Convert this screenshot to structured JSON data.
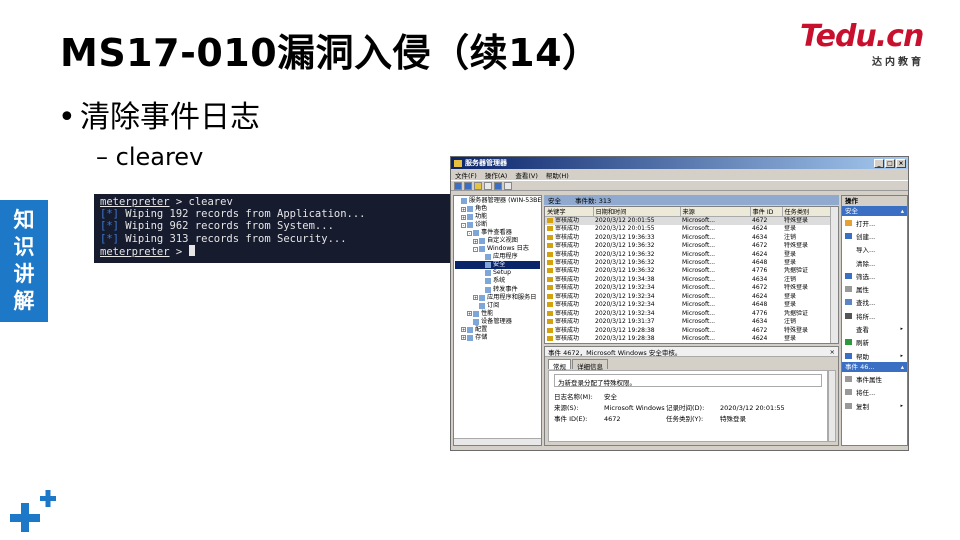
{
  "slide": {
    "title": "MS17-010漏洞入侵（续14）",
    "bullet": "清除事件日志",
    "sub_bullet": "– clearev",
    "side_tab": [
      "知",
      "识",
      "讲",
      "解"
    ]
  },
  "logo": {
    "main": "Tedu",
    "suffix": ".cn",
    "sub": "达内教育"
  },
  "colors": {
    "accent_blue": "#1e78c8",
    "logo_red": "#c8102e",
    "terminal_bg": "#161b2e"
  },
  "terminal": {
    "prompt": "meterpreter",
    "command": " > clearev",
    "lines": [
      {
        "tag": "[*]",
        "text": " Wiping 192 records from Application..."
      },
      {
        "tag": "[*]",
        "text": " Wiping 962 records from System..."
      },
      {
        "tag": "[*]",
        "text": " Wiping 313 records from Security..."
      }
    ],
    "prompt_end": " > "
  },
  "window": {
    "title": "服务器管理器",
    "menu": [
      "文件(F)",
      "操作(A)",
      "查看(V)",
      "帮助(H)"
    ],
    "tree": [
      {
        "label": "服务器管理器 (WIN-53BE",
        "level": 0,
        "exp": ""
      },
      {
        "label": "角色",
        "level": 1,
        "exp": "+"
      },
      {
        "label": "功能",
        "level": 1,
        "exp": "+"
      },
      {
        "label": "诊断",
        "level": 1,
        "exp": "-"
      },
      {
        "label": "事件查看器",
        "level": 2,
        "exp": "-"
      },
      {
        "label": "自定义视图",
        "level": 3,
        "exp": "+"
      },
      {
        "label": "Windows 日志",
        "level": 3,
        "exp": "-"
      },
      {
        "label": "应用程序",
        "level": 4,
        "exp": ""
      },
      {
        "label": "安全",
        "level": 4,
        "exp": "",
        "selected": true
      },
      {
        "label": "Setup",
        "level": 4,
        "exp": ""
      },
      {
        "label": "系统",
        "level": 4,
        "exp": ""
      },
      {
        "label": "转发事件",
        "level": 4,
        "exp": ""
      },
      {
        "label": "应用程序和服务日",
        "level": 3,
        "exp": "+"
      },
      {
        "label": "订阅",
        "level": 3,
        "exp": ""
      },
      {
        "label": "性能",
        "level": 2,
        "exp": "+"
      },
      {
        "label": "设备管理器",
        "level": 2,
        "exp": ""
      },
      {
        "label": "配置",
        "level": 1,
        "exp": "+"
      },
      {
        "label": "存储",
        "level": 1,
        "exp": "+"
      }
    ],
    "center_header": {
      "name": "安全",
      "count": "事件数: 313"
    },
    "columns": [
      "关键字",
      "日期和时间",
      "来源",
      "事件 ID",
      "任务类别"
    ],
    "rows": [
      [
        "审核成功",
        "2020/3/12 20:01:55",
        "Microsoft...",
        "4672",
        "特殊登录"
      ],
      [
        "审核成功",
        "2020/3/12 20:01:55",
        "Microsoft...",
        "4624",
        "登录"
      ],
      [
        "审核成功",
        "2020/3/12 19:36:33",
        "Microsoft...",
        "4634",
        "注销"
      ],
      [
        "审核成功",
        "2020/3/12 19:36:32",
        "Microsoft...",
        "4672",
        "特殊登录"
      ],
      [
        "审核成功",
        "2020/3/12 19:36:32",
        "Microsoft...",
        "4624",
        "登录"
      ],
      [
        "审核成功",
        "2020/3/12 19:36:32",
        "Microsoft...",
        "4648",
        "登录"
      ],
      [
        "审核成功",
        "2020/3/12 19:36:32",
        "Microsoft...",
        "4776",
        "凭据验证"
      ],
      [
        "审核成功",
        "2020/3/12 19:34:38",
        "Microsoft...",
        "4634",
        "注销"
      ],
      [
        "审核成功",
        "2020/3/12 19:32:34",
        "Microsoft...",
        "4672",
        "特殊登录"
      ],
      [
        "审核成功",
        "2020/3/12 19:32:34",
        "Microsoft...",
        "4624",
        "登录"
      ],
      [
        "审核成功",
        "2020/3/12 19:32:34",
        "Microsoft...",
        "4648",
        "登录"
      ],
      [
        "审核成功",
        "2020/3/12 19:32:34",
        "Microsoft...",
        "4776",
        "凭据验证"
      ],
      [
        "审核成功",
        "2020/3/12 19:31:37",
        "Microsoft...",
        "4634",
        "注销"
      ],
      [
        "审核成功",
        "2020/3/12 19:28:38",
        "Microsoft...",
        "4672",
        "特殊登录"
      ],
      [
        "审核成功",
        "2020/3/12 19:28:38",
        "Microsoft...",
        "4624",
        "登录"
      ]
    ],
    "detail": {
      "header": "事件 4672，Microsoft Windows 安全审核。",
      "close": "×",
      "tabs": [
        "常规",
        "详细信息"
      ],
      "message": "为新登录分配了特殊权限。",
      "fields": [
        {
          "label": "日志名称(M):",
          "value": "安全",
          "label2": "",
          "value2": ""
        },
        {
          "label": "来源(S):",
          "value": "Microsoft Windows 安全",
          "label2": "记录时间(D):",
          "value2": "2020/3/12 20:01:55"
        },
        {
          "label": "事件 ID(E):",
          "value": "4672",
          "label2": "任务类别(Y):",
          "value2": "特殊登录"
        }
      ]
    },
    "actions": {
      "header": "操作",
      "section1": "安全",
      "items1": [
        {
          "label": "打开...",
          "color": "#e3a233",
          "arrow": ""
        },
        {
          "label": "创建...",
          "color": "#3a6fc4",
          "arrow": ""
        },
        {
          "label": "导入...",
          "color": "",
          "arrow": ""
        },
        {
          "label": "清除...",
          "color": "",
          "arrow": ""
        },
        {
          "label": "筛选...",
          "color": "#3a6fc4",
          "arrow": ""
        },
        {
          "label": "属性",
          "color": "#999999",
          "arrow": ""
        },
        {
          "label": "查找...",
          "color": "#5b84c4",
          "arrow": ""
        },
        {
          "label": "将所...",
          "color": "#555555",
          "arrow": ""
        },
        {
          "label": "查看",
          "color": "",
          "arrow": "▸"
        },
        {
          "label": "刷新",
          "color": "#2a9a3a",
          "arrow": ""
        },
        {
          "label": "帮助",
          "color": "#3a6fc4",
          "arrow": "▸"
        }
      ],
      "section2": "事件 46...",
      "items2": [
        {
          "label": "事件属性",
          "color": "#999999",
          "arrow": ""
        },
        {
          "label": "将任...",
          "color": "#999999",
          "arrow": ""
        },
        {
          "label": "复制",
          "color": "#999999",
          "arrow": "▸"
        }
      ]
    }
  }
}
